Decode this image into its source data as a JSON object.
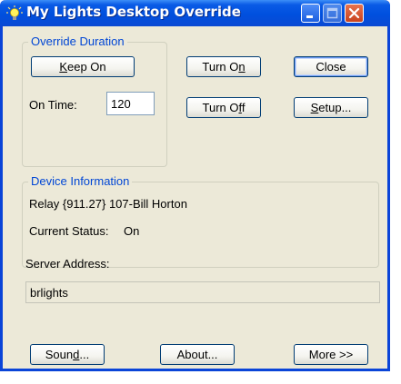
{
  "window": {
    "title": "My Lights Desktop Override"
  },
  "override": {
    "legend": "Override Duration",
    "keep_on": {
      "pre": "",
      "acc": "K",
      "post": "eep On"
    },
    "on_time_label": "On Time:",
    "on_time_value": "120"
  },
  "buttons": {
    "turn_on": {
      "pre": "Turn O",
      "acc": "n",
      "post": ""
    },
    "turn_off": {
      "pre": "Turn O",
      "acc": "f",
      "post": "f"
    },
    "close": "Close",
    "setup": {
      "pre": "",
      "acc": "S",
      "post": "etup..."
    },
    "sound": {
      "pre": "Soun",
      "acc": "d",
      "post": "..."
    },
    "about": "About...",
    "more": "More >>"
  },
  "device": {
    "legend": "Device Information",
    "relay": "Relay {911.27} 107-Bill Horton",
    "status_label": "Current Status:",
    "status_value": "On"
  },
  "server": {
    "label": "Server Address:",
    "value": "brlights"
  },
  "icons": {
    "app": "lightbulb-icon",
    "minimize": "minimize-icon",
    "maximize": "maximize-icon",
    "close": "close-icon"
  }
}
